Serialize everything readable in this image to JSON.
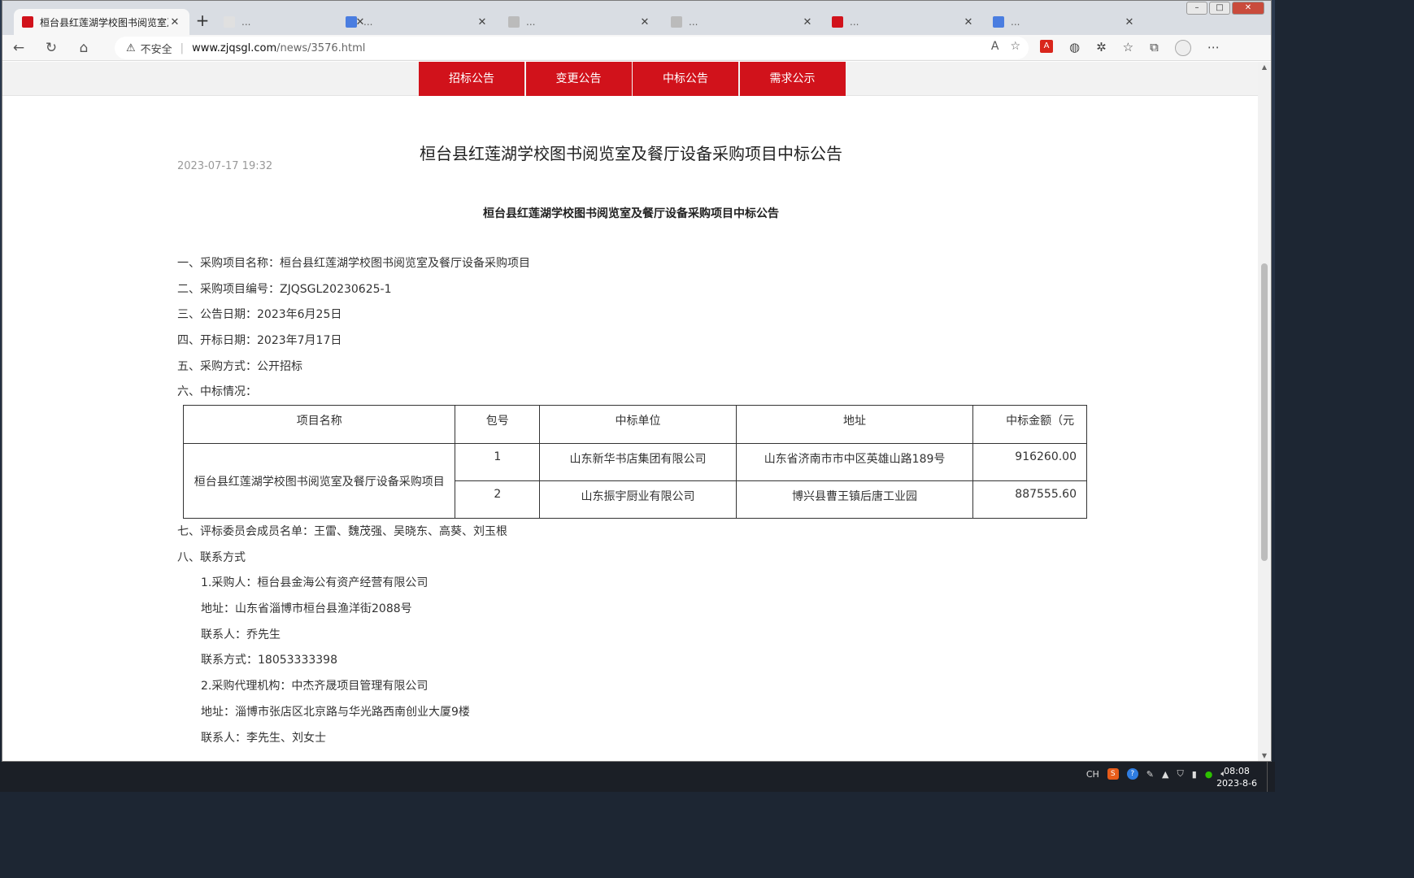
{
  "browser": {
    "tabs": [
      {
        "title": "桓台县红莲湖学校图书阅览室及餐厅设备采购项目中标公告",
        "active": true,
        "favicon_color": "#d1121b"
      },
      {
        "title": "...",
        "active": false,
        "favicon_color": "#e0e0e0"
      },
      {
        "title": "...",
        "active": false,
        "favicon_color": "#4a7de0"
      },
      {
        "title": "...",
        "active": false,
        "favicon_color": "#bbbbbb"
      },
      {
        "title": "...",
        "active": false,
        "favicon_color": "#bbbbbb"
      },
      {
        "title": "...",
        "active": false,
        "favicon_color": "#d1121b"
      },
      {
        "title": "...",
        "active": false,
        "favicon_color": "#4a7de0"
      }
    ],
    "new_tab_label": "+",
    "close_tab_label": "✕",
    "window_controls": {
      "minimize": "–",
      "maximize": "□",
      "close": "✕"
    },
    "address": {
      "security_label": "不安全",
      "url_host": "www.zjqsgl.com",
      "url_path": "/news/3576.html"
    },
    "icons": {
      "back": "←",
      "refresh": "↻",
      "home": "⌂",
      "read_aloud": "A",
      "favorite_add": "☆",
      "pdf": "A",
      "shield": "◍",
      "extensions": "✲",
      "favorites": "☆",
      "collections": "⧉",
      "more": "⋯"
    }
  },
  "site": {
    "nav": [
      "招标公告",
      "变更公告",
      "中标公告",
      "需求公示"
    ],
    "accent_color": "#d1121b"
  },
  "article": {
    "title": "桓台县红莲湖学校图书阅览室及餐厅设备采购项目中标公告",
    "date": "2023-07-17 19:32",
    "subtitle": "桓台县红莲湖学校图书阅览室及餐厅设备采购项目中标公告",
    "lines": [
      "一、采购项目名称：桓台县红莲湖学校图书阅览室及餐厅设备采购项目",
      "二、采购项目编号：ZJQSGL20230625-1",
      "三、公告日期：2023年6月25日",
      "四、开标日期：2023年7月17日",
      "五、采购方式：公开招标",
      "六、中标情况："
    ],
    "table": {
      "headers": [
        "项目名称",
        "包号",
        "中标单位",
        "地址",
        "中标金额（元"
      ],
      "project_name": "桓台县红莲湖学校图书阅览室及餐厅设备采购项目",
      "rows": [
        {
          "pkg": "1",
          "winner": "山东新华书店集团有限公司",
          "address": "山东省济南市市中区英雄山路189号",
          "amount": "916260.00"
        },
        {
          "pkg": "2",
          "winner": "山东振宇厨业有限公司",
          "address": "博兴县曹王镇后唐工业园",
          "amount": "887555.60"
        }
      ]
    },
    "lines_after": [
      {
        "text": "七、评标委员会成员名单：王雷、魏茂强、吴晓东、高葵、刘玉根",
        "indent": false
      },
      {
        "text": "八、联系方式",
        "indent": false
      },
      {
        "text": "1.采购人：桓台县金海公有资产经营有限公司",
        "indent": true
      },
      {
        "text": "地址：山东省淄博市桓台县渔洋街2088号",
        "indent": true
      },
      {
        "text": "联系人：乔先生",
        "indent": true
      },
      {
        "text": "联系方式：18053333398",
        "indent": true
      },
      {
        "text": "2.采购代理机构：中杰齐晟项目管理有限公司",
        "indent": true
      },
      {
        "text": "地址：淄博市张店区北京路与华光路西南创业大厦9楼",
        "indent": true
      },
      {
        "text": "联系人：李先生、刘女士",
        "indent": true
      }
    ]
  },
  "taskbar": {
    "input_lang": "CH",
    "sogou": "S",
    "help": "?",
    "time": "08:08",
    "date": "2023-8-6"
  }
}
